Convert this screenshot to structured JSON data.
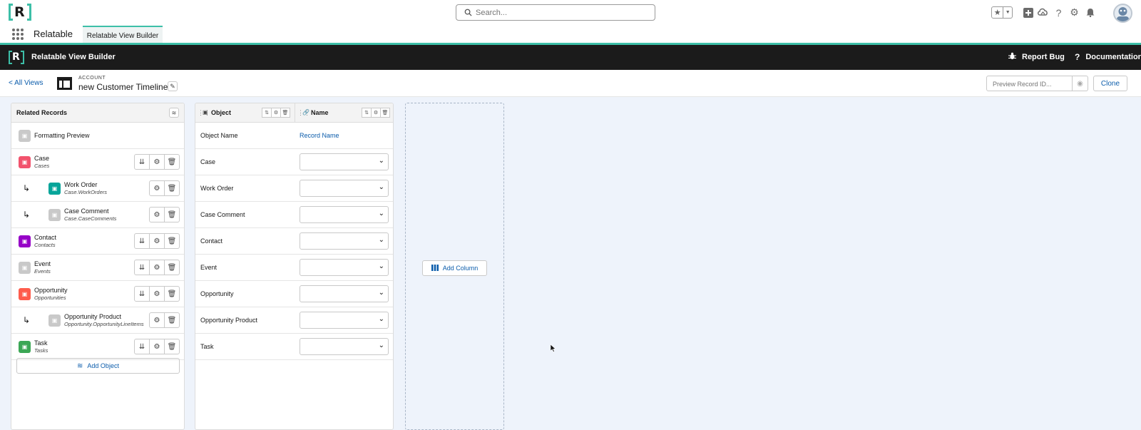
{
  "global_header": {
    "logo_letter": "R",
    "search_placeholder": "Search...",
    "app_name": "Relatable",
    "app_tab": "Relatable View Builder",
    "icons": [
      "favorites-star-icon",
      "add-icon",
      "trailhead-icon",
      "help-icon",
      "setup-gear-icon",
      "notifications-bell-icon",
      "avatar"
    ]
  },
  "toolbar": {
    "logo_letter": "R",
    "title": "Relatable View Builder",
    "report_bug": "Report Bug",
    "documentation": "Documentation"
  },
  "view_header": {
    "back_link": "< All Views",
    "object_eyebrow": "ACCOUNT",
    "view_title": "new Customer Timeline",
    "preview_placeholder": "Preview Record ID...",
    "clone_label": "Clone"
  },
  "related_records": {
    "title": "Related Records",
    "items": [
      {
        "name": "Formatting Preview",
        "api": "",
        "child": false,
        "icon": "formatting-icon",
        "color": "#c9c9c9",
        "has_reorder": false,
        "has_actions": false
      },
      {
        "name": "Case",
        "api": "Cases",
        "child": false,
        "icon": "case-icon",
        "color": "#f2536d",
        "has_reorder": true,
        "has_actions": true
      },
      {
        "name": "Work Order",
        "api": "Case.WorkOrders",
        "child": true,
        "icon": "work-order-icon",
        "color": "#06a59a",
        "has_reorder": false,
        "has_actions": true
      },
      {
        "name": "Case Comment",
        "api": "Case.CaseComments",
        "child": true,
        "icon": "case-comment-icon",
        "color": "#c9c9c9",
        "has_reorder": false,
        "has_actions": true
      },
      {
        "name": "Contact",
        "api": "Contacts",
        "child": false,
        "icon": "contact-icon",
        "color": "#9602c7",
        "has_reorder": true,
        "has_actions": true
      },
      {
        "name": "Event",
        "api": "Events",
        "child": false,
        "icon": "event-icon",
        "color": "#c9c9c9",
        "has_reorder": true,
        "has_actions": true
      },
      {
        "name": "Opportunity",
        "api": "Opportunities",
        "child": false,
        "icon": "opportunity-icon",
        "color": "#fe5c4c",
        "has_reorder": true,
        "has_actions": true
      },
      {
        "name": "Opportunity Product",
        "api": "Opportunity.OpportunityLineItems",
        "child": true,
        "icon": "opportunity-product-icon",
        "color": "#c9c9c9",
        "has_reorder": false,
        "has_actions": true
      },
      {
        "name": "Task",
        "api": "Tasks",
        "child": false,
        "icon": "task-icon",
        "color": "#3ba755",
        "has_reorder": true,
        "has_actions": true
      }
    ],
    "add_object_label": "Add Object"
  },
  "columns": {
    "object_header": "Object",
    "name_header": "Name",
    "header_row": {
      "label": "Object Name",
      "value": "Record Name"
    },
    "rows": [
      "Case",
      "Work Order",
      "Case Comment",
      "Contact",
      "Event",
      "Opportunity",
      "Opportunity Product",
      "Task"
    ],
    "add_column_label": "Add Column"
  },
  "colors": {
    "brand_teal": "#3dbfa8",
    "toolbar_dark": "#1b1b1b",
    "link_blue": "#0b5cab",
    "canvas_bg": "#eef3fb"
  }
}
